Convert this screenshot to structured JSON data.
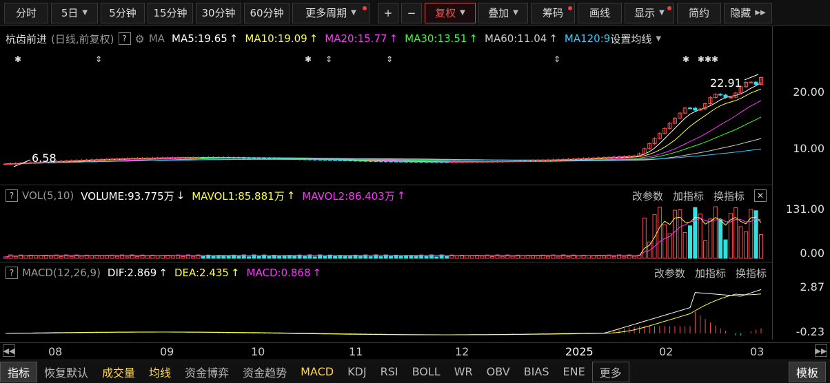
{
  "toolbar": {
    "periods": [
      "分时",
      "5日",
      "5分钟",
      "15分钟",
      "30分钟",
      "60分钟"
    ],
    "more_period": "更多周期",
    "plus": "+",
    "minus": "−",
    "fuquan": "复权",
    "diejia": "叠加",
    "chouma": "筹码",
    "huaxian": "画线",
    "xianshi": "显示",
    "jianyue": "简约",
    "yincang": "隐藏"
  },
  "main": {
    "stock_name": "杭齿前进",
    "mode": "(日线,前复权)",
    "ma_label": "MA",
    "ma5": "MA5:19.65",
    "ma10": "MA10:19.09",
    "ma20": "MA20:15.77",
    "ma30": "MA30:13.51",
    "ma60": "MA60:11.04",
    "ma120": "MA120:9",
    "set_ma": "设置均线",
    "high_label": "22.91",
    "low_label": "6.58",
    "y_ticks": [
      "20.00",
      "10.00"
    ]
  },
  "vol": {
    "title": "VOL(5,10)",
    "volume": "VOLUME:93.775万",
    "mavol1": "MAVOL1:85.881万",
    "mavol2": "MAVOL2:86.403万",
    "y_ticks": [
      "131.00",
      "0.00"
    ]
  },
  "macd": {
    "title": "MACD(12,26,9)",
    "dif": "DIF:2.869",
    "dea": "DEA:2.435",
    "macd": "MACD:0.868",
    "y_ticks": [
      "2.87",
      "-0.23"
    ]
  },
  "sub_actions": {
    "params": "改参数",
    "add": "加指标",
    "swap": "换指标"
  },
  "time_axis": [
    "08",
    "09",
    "10",
    "11",
    "12",
    "2025",
    "02",
    "03"
  ],
  "bottom_tabs": [
    "指标",
    "恢复默认",
    "成交量",
    "均线",
    "资金博弈",
    "资金趋势",
    "MACD",
    "KDJ",
    "RSI",
    "BOLL",
    "WR",
    "OBV",
    "BIAS",
    "ENE"
  ],
  "more": "更多",
  "template": "模板",
  "colors": {
    "up": "#ff4d4d",
    "down": "#33e0e0",
    "ma5": "#ffffff",
    "ma10": "#ffff33",
    "ma20": "#ff33ff",
    "ma30": "#33ff33",
    "ma60": "#cccccc",
    "ma120": "#33ccff"
  }
}
